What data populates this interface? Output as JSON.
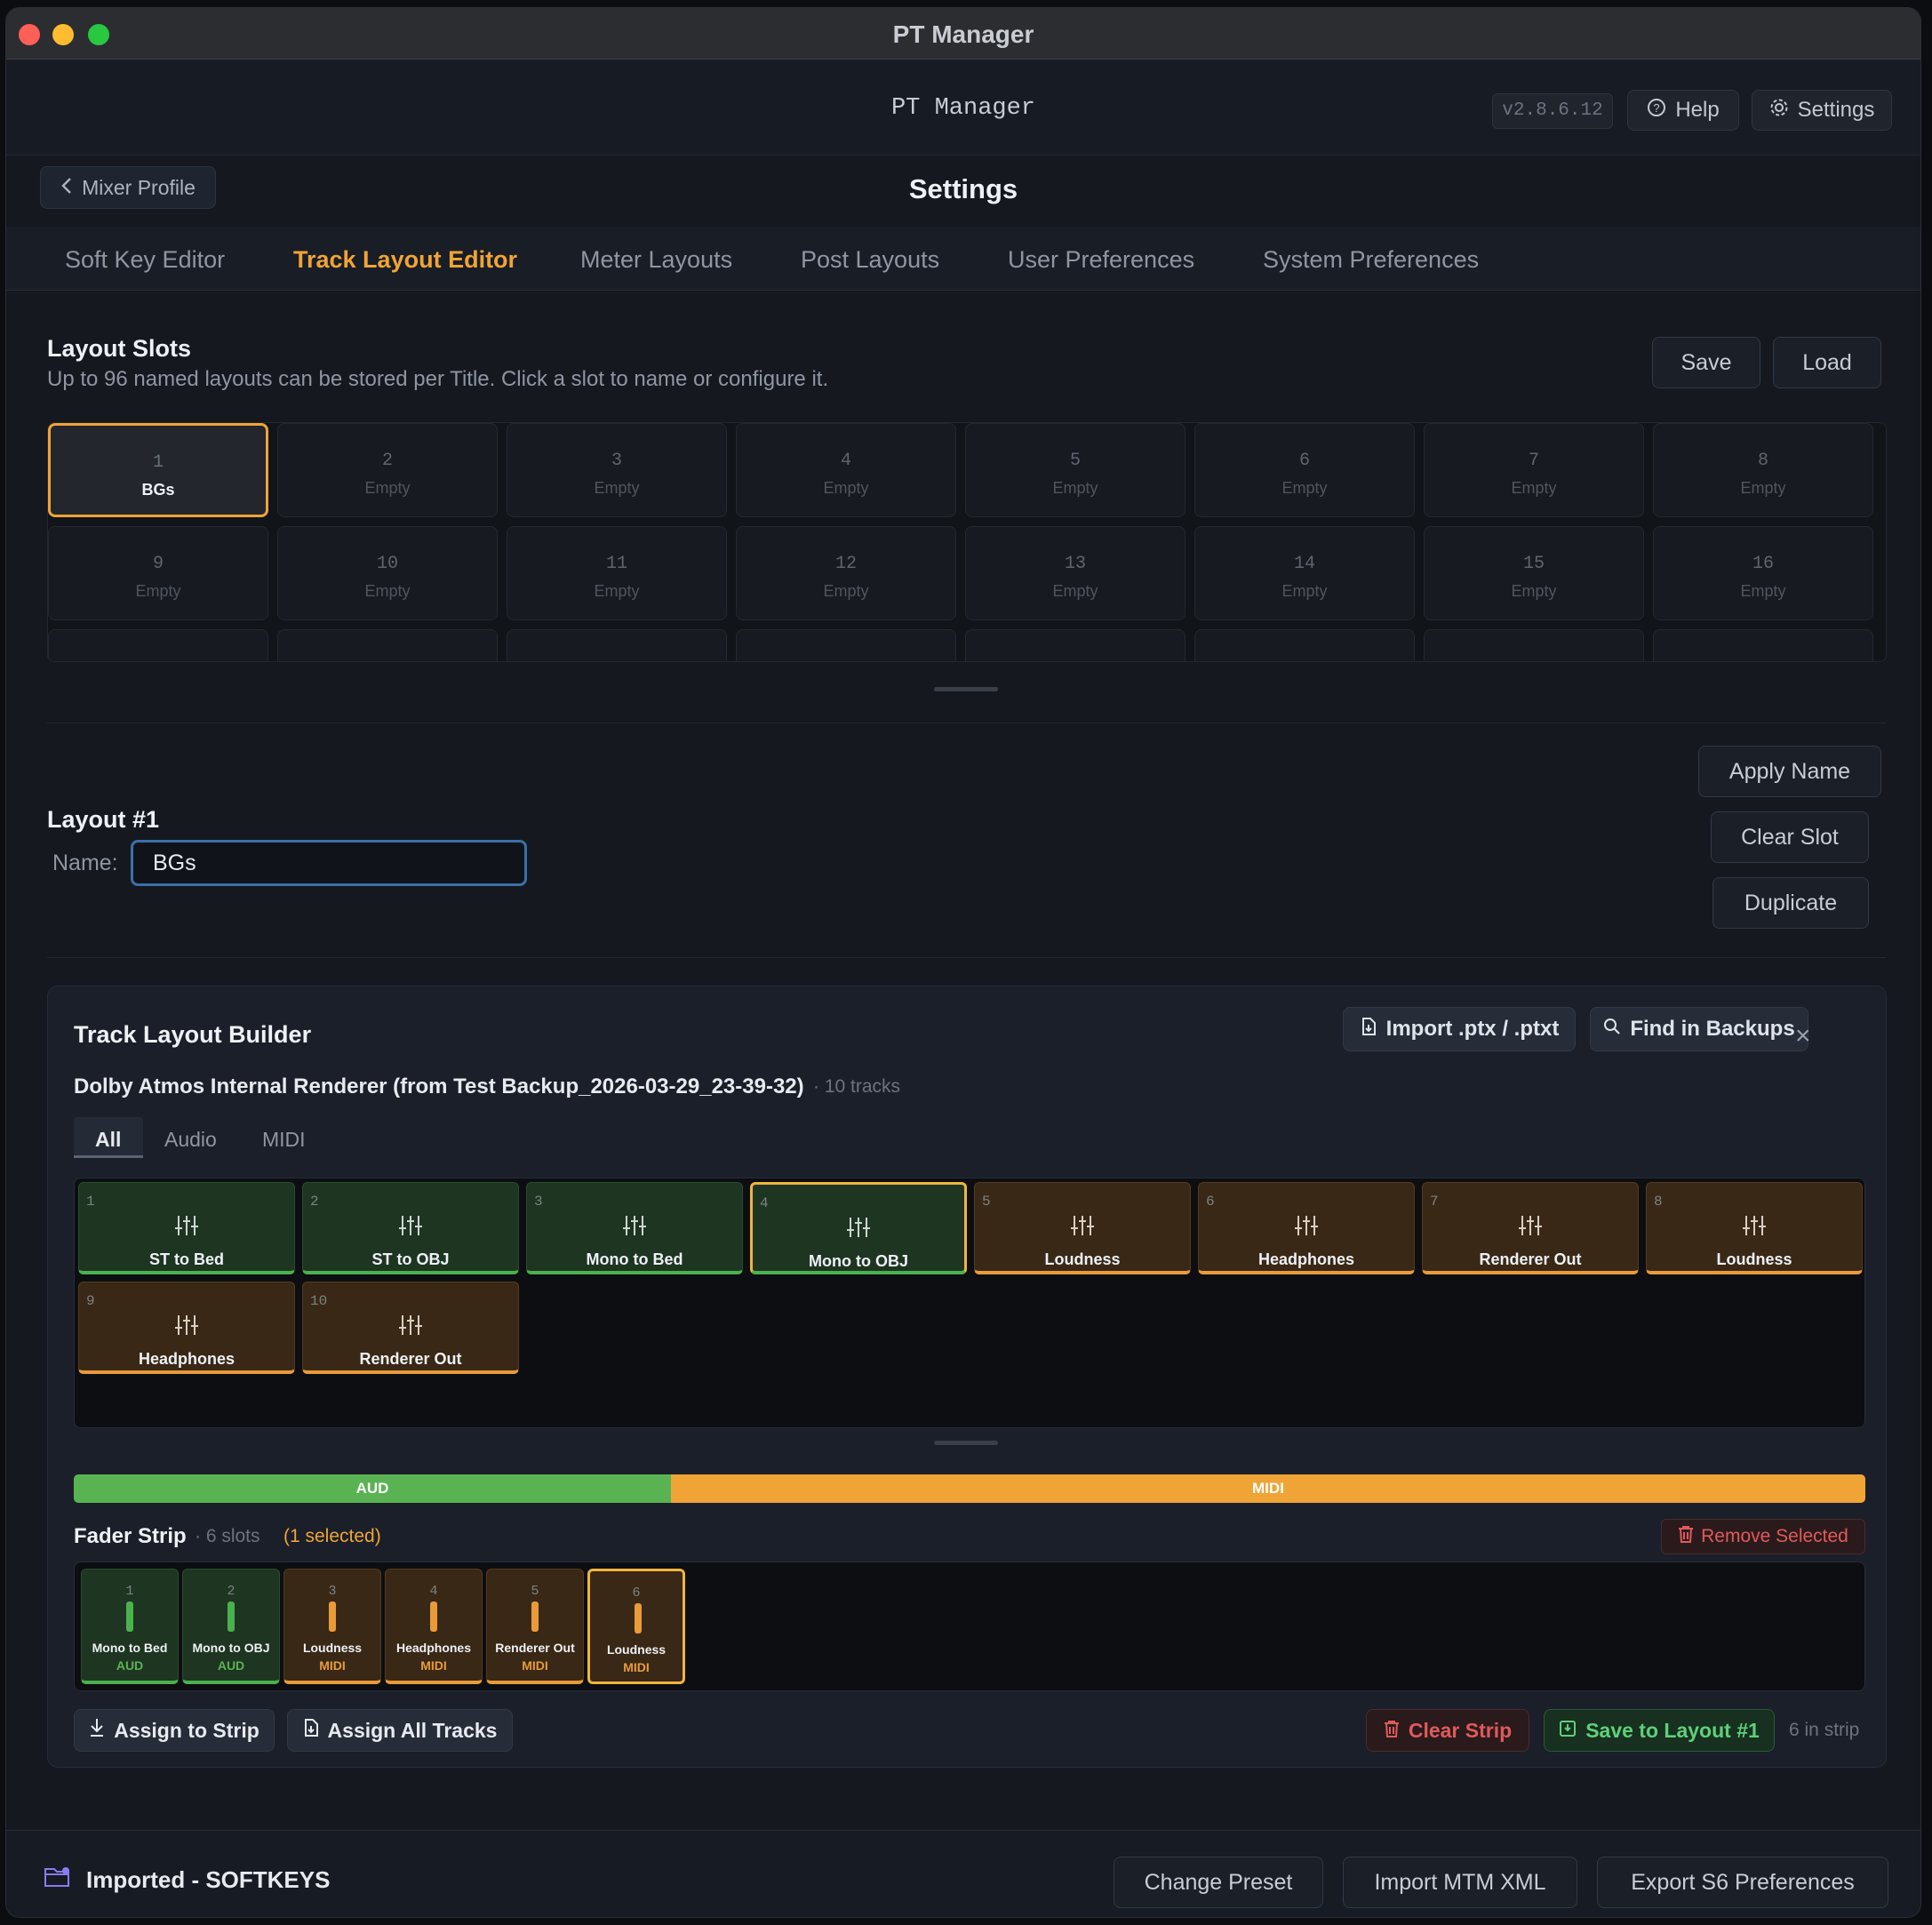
{
  "window": {
    "title": "PT Manager"
  },
  "header": {
    "app_name": "PT Manager",
    "version": "v2.8.6.12",
    "help_label": "Help",
    "settings_label": "Settings"
  },
  "page": {
    "back_label": "Mixer Profile",
    "title": "Settings"
  },
  "tabs": [
    {
      "label": "Soft Key Editor",
      "active": false
    },
    {
      "label": "Track Layout Editor",
      "active": true
    },
    {
      "label": "Meter Layouts",
      "active": false
    },
    {
      "label": "Post Layouts",
      "active": false
    },
    {
      "label": "User Preferences",
      "active": false
    },
    {
      "label": "System Preferences",
      "active": false
    }
  ],
  "layout_slots": {
    "title": "Layout Slots",
    "subtitle": "Up to 96 named layouts can be stored per Title. Click a slot to name or configure it.",
    "save_label": "Save",
    "load_label": "Load",
    "slots": [
      {
        "num": "1",
        "label": "BGs",
        "selected": true
      },
      {
        "num": "2",
        "label": "Empty"
      },
      {
        "num": "3",
        "label": "Empty"
      },
      {
        "num": "4",
        "label": "Empty"
      },
      {
        "num": "5",
        "label": "Empty"
      },
      {
        "num": "6",
        "label": "Empty"
      },
      {
        "num": "7",
        "label": "Empty"
      },
      {
        "num": "8",
        "label": "Empty"
      },
      {
        "num": "9",
        "label": "Empty"
      },
      {
        "num": "10",
        "label": "Empty"
      },
      {
        "num": "11",
        "label": "Empty"
      },
      {
        "num": "12",
        "label": "Empty"
      },
      {
        "num": "13",
        "label": "Empty"
      },
      {
        "num": "14",
        "label": "Empty"
      },
      {
        "num": "15",
        "label": "Empty"
      },
      {
        "num": "16",
        "label": "Empty"
      }
    ]
  },
  "layout_detail": {
    "title": "Layout #1",
    "name_label": "Name:",
    "name_value": "BGs",
    "apply_label": "Apply Name",
    "clear_label": "Clear Slot",
    "duplicate_label": "Duplicate"
  },
  "builder": {
    "title": "Track Layout Builder",
    "import_label": "Import .ptx / .ptxt",
    "find_label": "Find in Backups",
    "close_label": "×",
    "source": "Dolby Atmos Internal Renderer (from Test Backup_2026-03-29_23-39-32)",
    "track_count": "· 10 tracks",
    "filters": [
      "All",
      "Audio",
      "MIDI"
    ],
    "tracks": [
      {
        "num": "1",
        "label": "ST to Bed",
        "type": "aud"
      },
      {
        "num": "2",
        "label": "ST to OBJ",
        "type": "aud"
      },
      {
        "num": "3",
        "label": "Mono to Bed",
        "type": "aud"
      },
      {
        "num": "4",
        "label": "Mono to OBJ",
        "type": "aud",
        "selected": true
      },
      {
        "num": "5",
        "label": "Loudness",
        "type": "midi"
      },
      {
        "num": "6",
        "label": "Headphones",
        "type": "midi"
      },
      {
        "num": "7",
        "label": "Renderer Out",
        "type": "midi"
      },
      {
        "num": "8",
        "label": "Loudness",
        "type": "midi"
      },
      {
        "num": "9",
        "label": "Headphones",
        "type": "midi"
      },
      {
        "num": "10",
        "label": "Renderer Out",
        "type": "midi"
      }
    ],
    "typebar": {
      "aud_label": "AUD",
      "midi_label": "MIDI"
    },
    "fader_strip": {
      "title": "Fader Strip",
      "slots_text": "· 6 slots",
      "selected_text": "(1 selected)",
      "remove_label": "Remove Selected",
      "channels": [
        {
          "num": "1",
          "label": "Mono to Bed",
          "type_label": "AUD",
          "type": "aud"
        },
        {
          "num": "2",
          "label": "Mono to OBJ",
          "type_label": "AUD",
          "type": "aud"
        },
        {
          "num": "3",
          "label": "Loudness",
          "type_label": "MIDI",
          "type": "midi"
        },
        {
          "num": "4",
          "label": "Headphones",
          "type_label": "MIDI",
          "type": "midi"
        },
        {
          "num": "5",
          "label": "Renderer Out",
          "type_label": "MIDI",
          "type": "midi"
        },
        {
          "num": "6",
          "label": "Loudness",
          "type_label": "MIDI",
          "type": "midi",
          "selected": true
        }
      ]
    },
    "assign_label": "Assign to Strip",
    "assign_all_label": "Assign All Tracks",
    "clear_strip_label": "Clear Strip",
    "save_layout_label": "Save to Layout #1",
    "in_strip_text": "6 in strip"
  },
  "footer": {
    "preset_name": "Imported - SOFTKEYS",
    "change_preset_label": "Change Preset",
    "import_mtm_label": "Import MTM XML",
    "export_label": "Export S6 Preferences"
  },
  "colors": {
    "accent": "#f0a436",
    "audio": "#4bb04e",
    "midi": "#e99b3a",
    "danger": "#e05a5a",
    "focus": "#3b6fa8"
  }
}
